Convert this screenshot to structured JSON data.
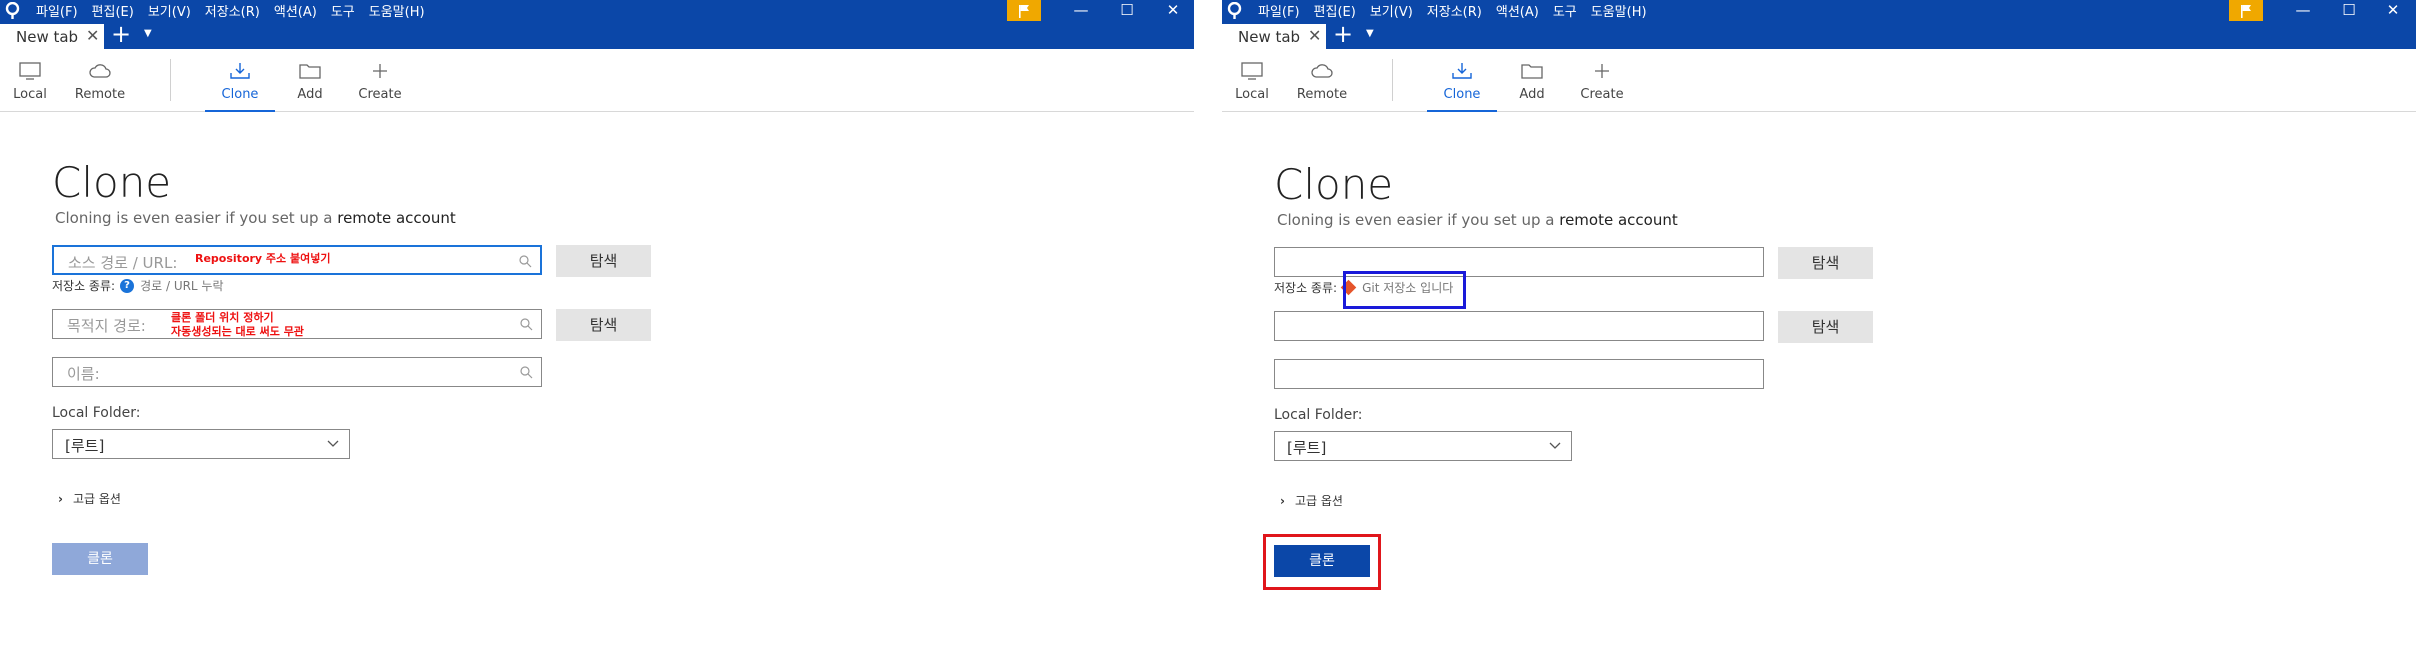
{
  "menu": [
    "파일(F)",
    "편집(E)",
    "보기(V)",
    "저장소(R)",
    "액션(A)",
    "도구",
    "도움말(H)"
  ],
  "window_controls": {
    "minimize": "—",
    "maximize": "☐",
    "close": "✕"
  },
  "tab": {
    "label": "New tab",
    "close": "✕",
    "add": "+",
    "dropdown": "▼"
  },
  "toolbar": {
    "local": "Local",
    "remote": "Remote",
    "clone": "Clone",
    "add": "Add",
    "create": "Create"
  },
  "page": {
    "title": "Clone",
    "subtitle_prefix": "Cloning is even easier if you set up a",
    "subtitle_link": "remote account"
  },
  "form": {
    "source_placeholder": "소스 경로 / URL:",
    "dest_placeholder": "목적지 경로:",
    "name_placeholder": "이름:",
    "browse_label": "탐색",
    "repo_type_label": "저장소 종류:",
    "repo_type_missing": "경로 / URL 누락",
    "repo_type_git": "Git 저장소 입니다",
    "local_folder_label": "Local Folder:",
    "local_folder_value": "[루트]",
    "advanced_label": "고급 옵션",
    "clone_button": "클론"
  },
  "annotations": {
    "source_note": "Repository 주소 붙여넣기",
    "dest_note_1": "클론 폴더 위치 정하기",
    "dest_note_2": "자동생성되는 대로 써도 무관"
  },
  "colors": {
    "brand": "#0b47a8",
    "accent": "#1565d8",
    "flag": "#f0a800",
    "annotation": "#e11111"
  }
}
